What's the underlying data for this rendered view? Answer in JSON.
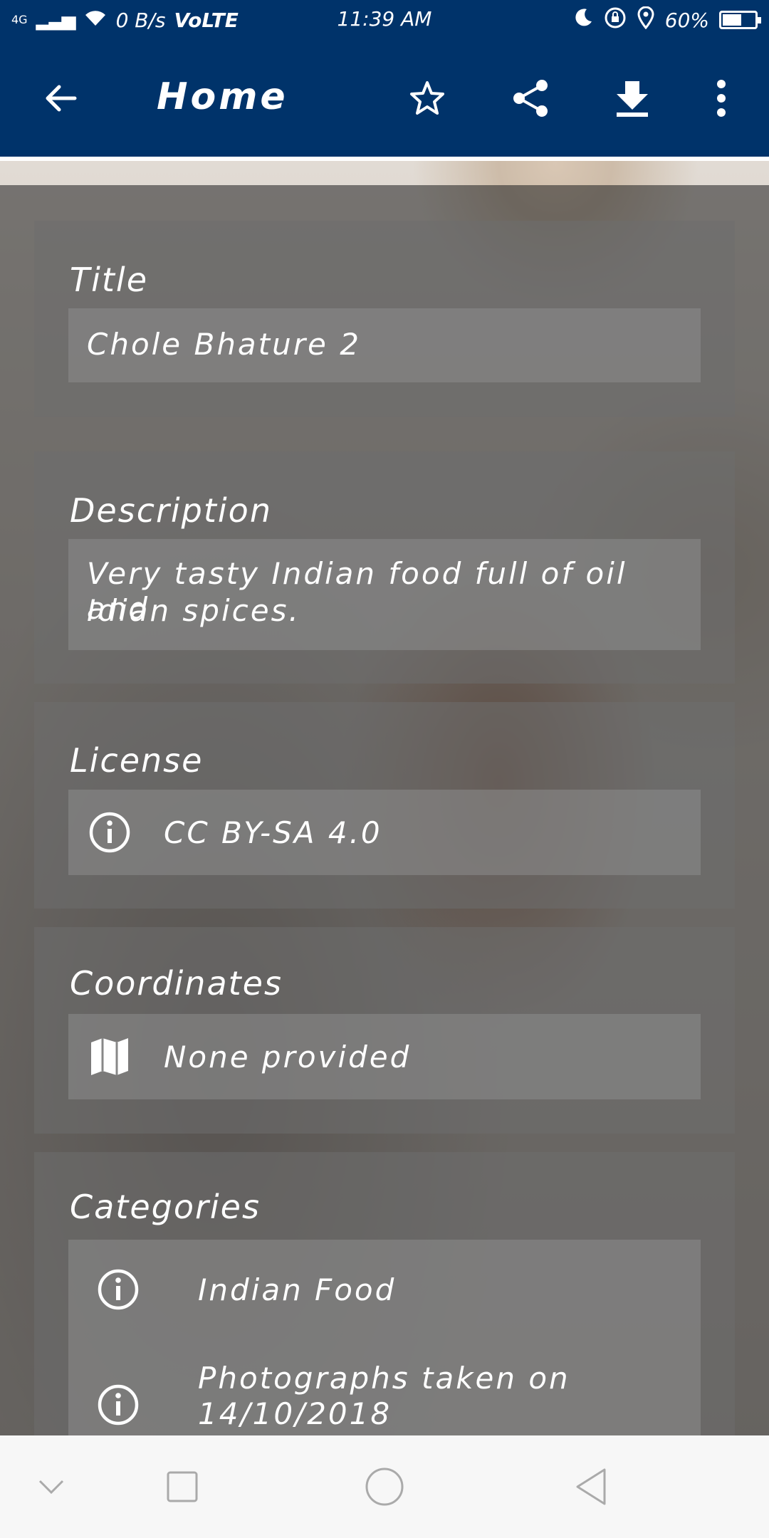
{
  "status_bar": {
    "network": "4G",
    "speed": "0 B/s",
    "volte": "VoLTE",
    "time": "11:39 AM",
    "battery": "60%",
    "battery_level": 0.6
  },
  "app_bar": {
    "title": "Home",
    "back_icon": "arrow-left-icon",
    "star_icon": "star-outline-icon",
    "share_icon": "share-icon",
    "download_icon": "download-icon",
    "menu_icon": "more-vert-icon"
  },
  "colors": {
    "primary": "#00336a",
    "card_bg": "#6e6e6e",
    "field_bg": "#8c8c8c",
    "text": "#ffffff"
  },
  "cards": {
    "title": {
      "label": "Title",
      "value": "Chole Bhature 2"
    },
    "description": {
      "label": "Description",
      "value_line1": "Very tasty Indian food full of oil and",
      "value_line2": "Idian spices."
    },
    "license": {
      "label": "License",
      "value": "CC BY-SA 4.0",
      "icon": "info-icon"
    },
    "coordinates": {
      "label": "Coordinates",
      "value": "None provided",
      "icon": "map-icon"
    },
    "categories": {
      "label": "Categories",
      "items": [
        {
          "text": "Indian Food",
          "icon": "info-icon"
        },
        {
          "text_line1": "Photographs taken on",
          "text_line2": "14/10/2018",
          "icon": "info-icon"
        }
      ]
    }
  },
  "nav_bar": {
    "down_icon": "chevron-down-icon",
    "recents_icon": "square-icon",
    "home_icon": "circle-icon",
    "back_icon": "triangle-back-icon"
  }
}
